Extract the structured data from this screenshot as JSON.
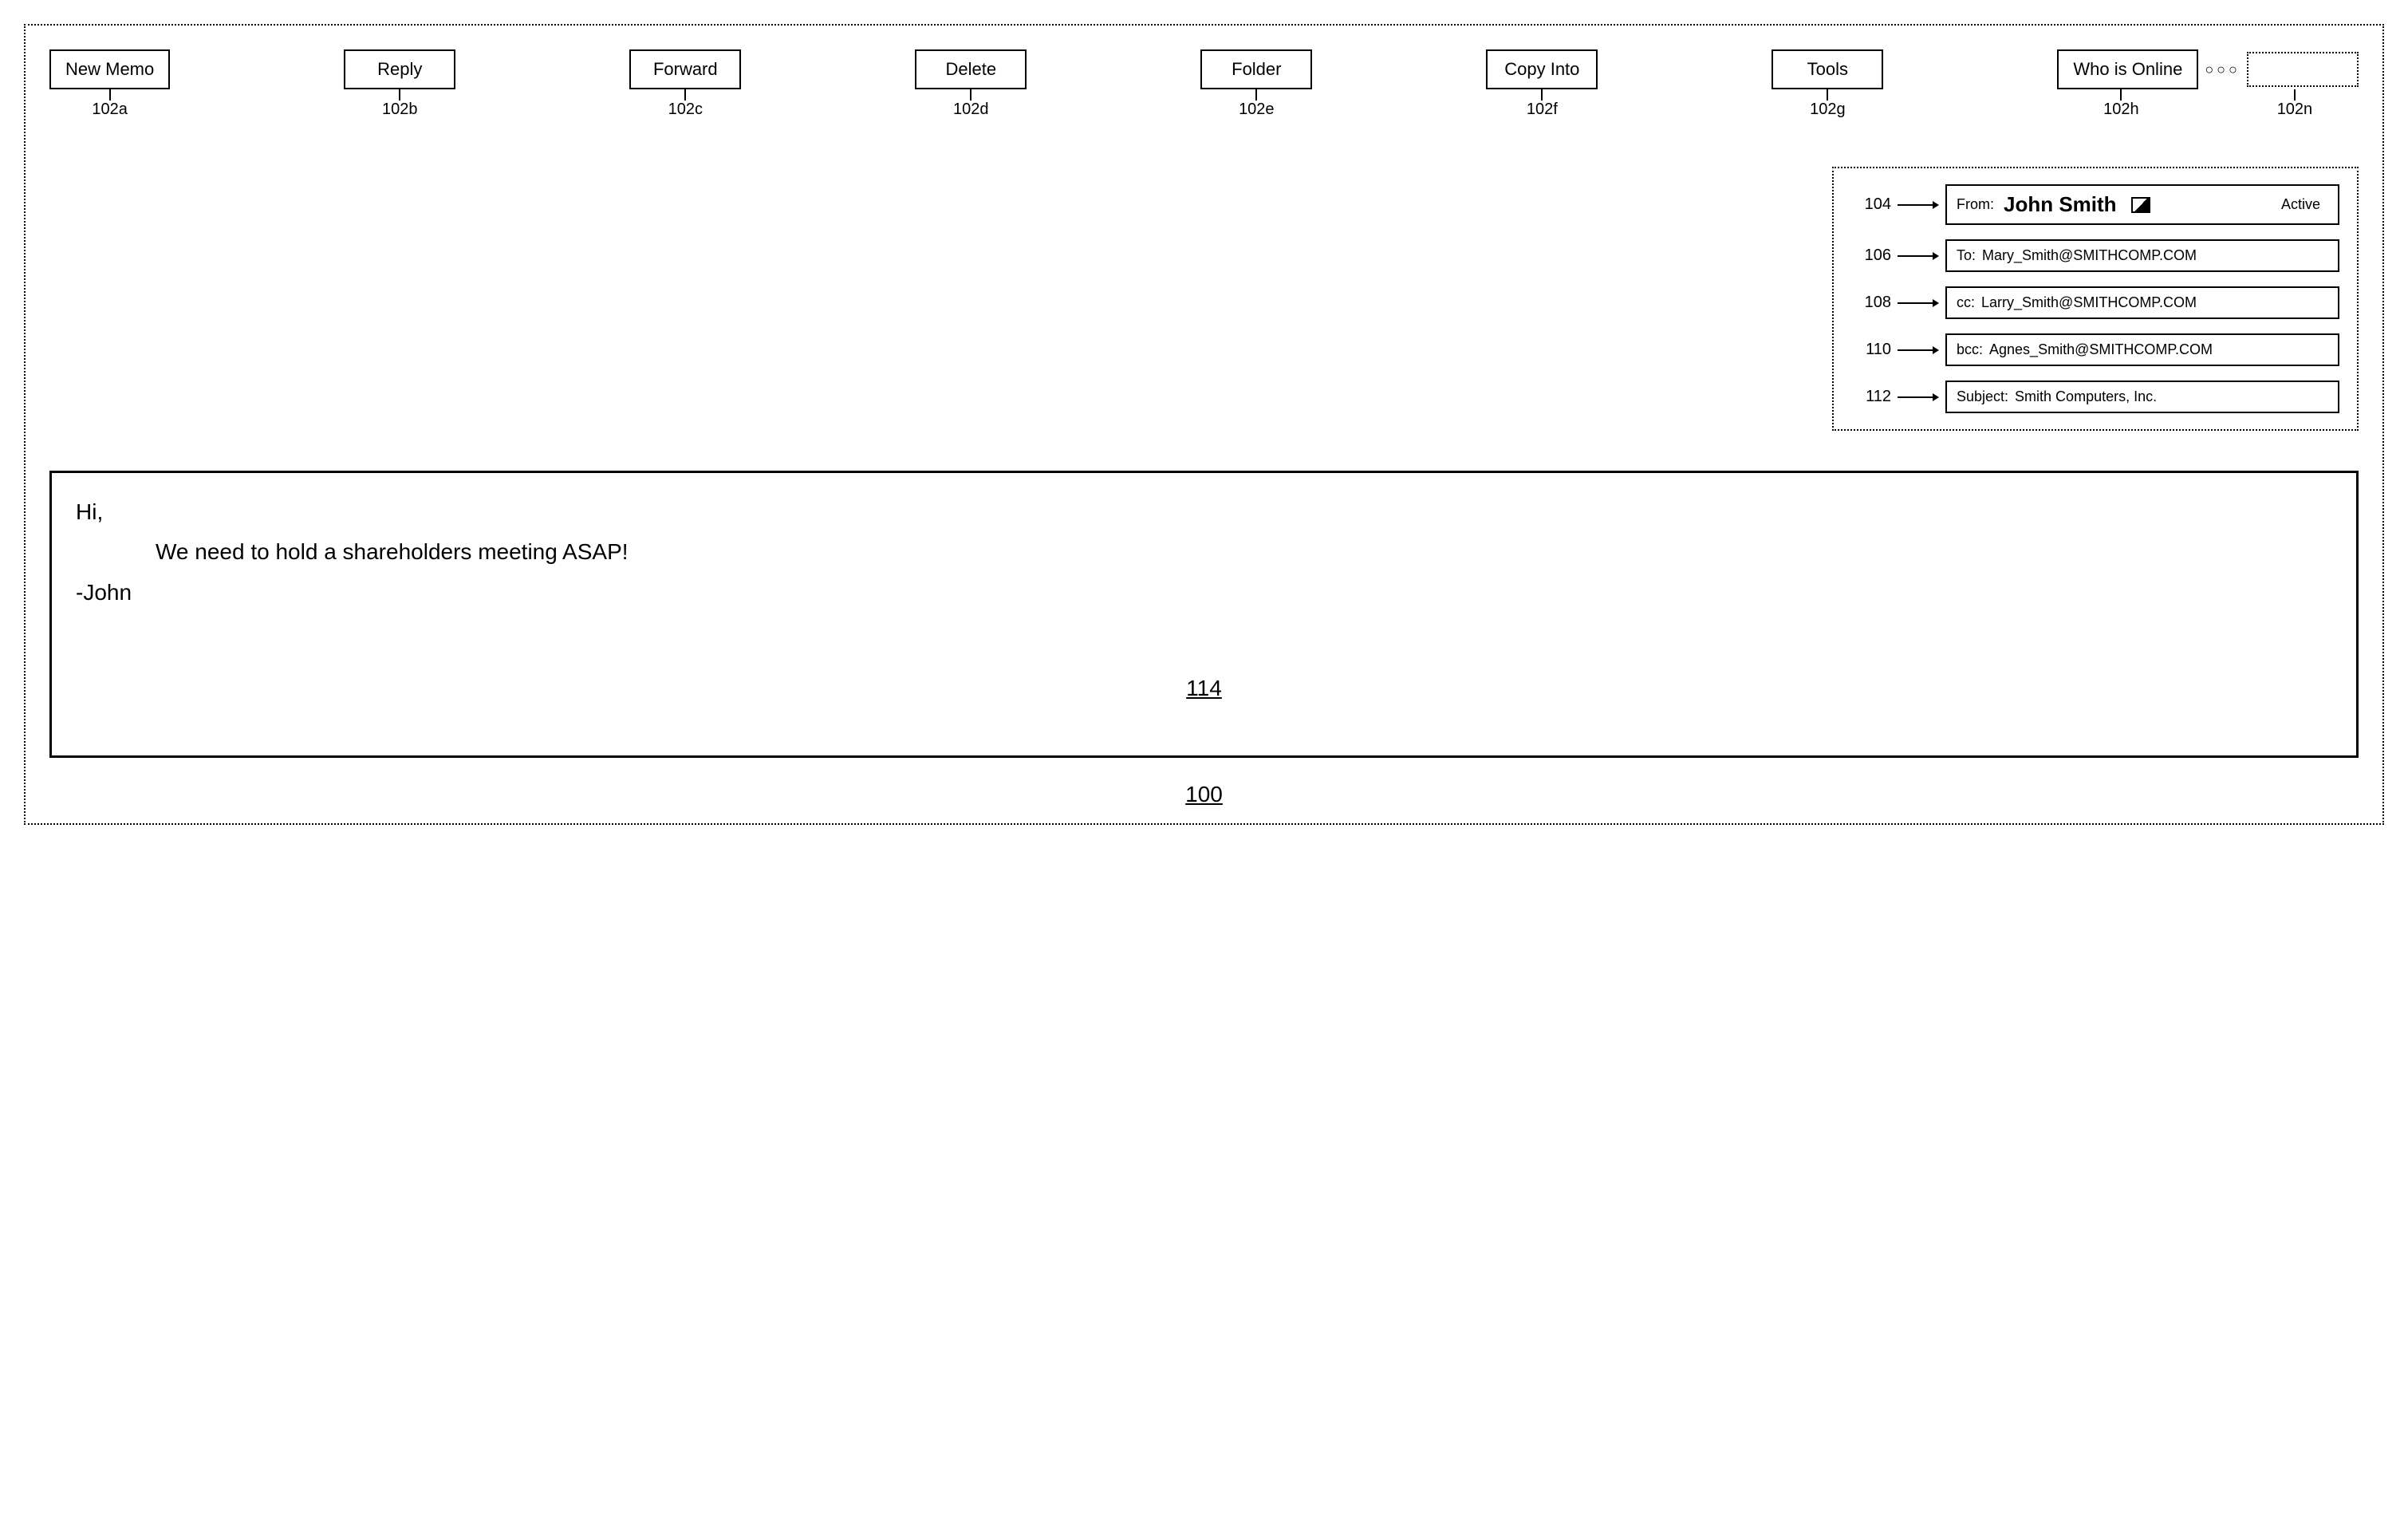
{
  "toolbar": {
    "buttons": [
      {
        "label": "New Memo",
        "ref": "102a"
      },
      {
        "label": "Reply",
        "ref": "102b"
      },
      {
        "label": "Forward",
        "ref": "102c"
      },
      {
        "label": "Delete",
        "ref": "102d"
      },
      {
        "label": "Folder",
        "ref": "102e"
      },
      {
        "label": "Copy Into",
        "ref": "102f"
      },
      {
        "label": "Tools",
        "ref": "102g"
      },
      {
        "label": "Who is Online",
        "ref": "102h"
      }
    ],
    "ellipsis": "○○○",
    "placeholder_ref": "102n"
  },
  "header": {
    "from": {
      "ref": "104",
      "label": "From:",
      "name": "John Smith",
      "status": "Active"
    },
    "to": {
      "ref": "106",
      "label": "To:",
      "value": "Mary_Smith@SMITHCOMP.COM"
    },
    "cc": {
      "ref": "108",
      "label": "cc:",
      "value": "Larry_Smith@SMITHCOMP.COM"
    },
    "bcc": {
      "ref": "110",
      "label": "bcc:",
      "value": "Agnes_Smith@SMITHCOMP.COM"
    },
    "subject": {
      "ref": "112",
      "label": "Subject:",
      "value": "Smith Computers, Inc."
    }
  },
  "body": {
    "greeting": "Hi,",
    "line1": "We need to hold a shareholders meeting ASAP!",
    "signoff": "-John",
    "ref": "114"
  },
  "figure_ref": "100"
}
